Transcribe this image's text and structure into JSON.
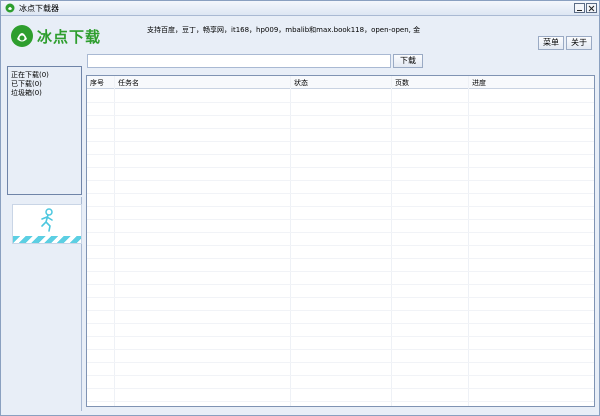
{
  "window": {
    "title": "冰点下载器"
  },
  "header": {
    "logo_text": "冰点下载",
    "support_text": "支持百度，豆丁，畅享网，it168，hp009，mbalib和max.book118，open-open, 金",
    "menu_label": "菜单",
    "about_label": "关于"
  },
  "sidebar": {
    "items": [
      {
        "label": "正在下载(0)"
      },
      {
        "label": "已下载(0)"
      },
      {
        "label": "垃圾箱(0)"
      }
    ]
  },
  "toolbar": {
    "url_value": "",
    "download_label": "下载"
  },
  "table": {
    "columns": [
      "序号",
      "任务名",
      "状态",
      "页数",
      "进度"
    ],
    "rows": []
  },
  "colors": {
    "accent": "#2e9e2e",
    "stripe": "#5ccfe3"
  }
}
